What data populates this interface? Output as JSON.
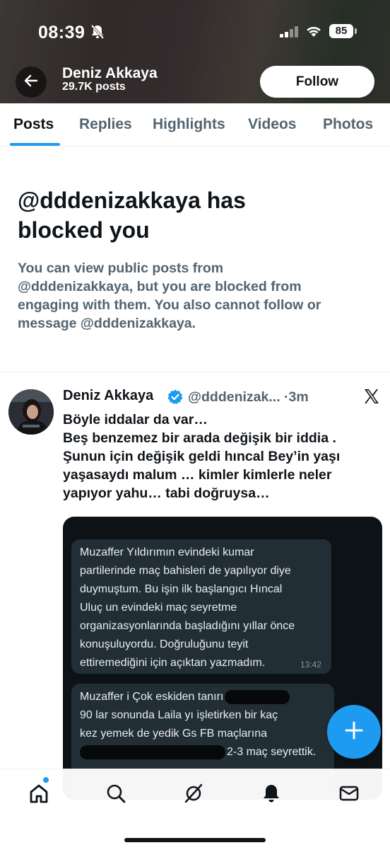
{
  "status_bar": {
    "time": "08:39",
    "battery": "85"
  },
  "profile_header": {
    "name": "Deniz Akkaya",
    "post_count": "29.7K posts",
    "follow_label": "Follow"
  },
  "tabs": [
    {
      "label": "Posts",
      "active": true
    },
    {
      "label": "Replies",
      "active": false
    },
    {
      "label": "Highlights",
      "active": false
    },
    {
      "label": "Videos",
      "active": false
    },
    {
      "label": "Photos",
      "active": false
    }
  ],
  "blocked": {
    "title_lines": [
      "@dddenizakkaya has",
      "blocked you"
    ],
    "message_lines": [
      "You can view public posts from",
      "@dddenizakkaya, but you are blocked from",
      "engaging with them. You also cannot follow or",
      "message @dddenizakkaya."
    ]
  },
  "post": {
    "author_name": "Deniz Akkaya",
    "handle_time": "@dddenizak... ·3m",
    "lines": [
      "Böyle iddalar da var…",
      "Beş benzemez bir arada değişik bir iddia .",
      "Şunun için değişik geldi hıncal Bey’in yaşı",
      "yaşasaydı malum … kimler kimlerle neler",
      "yapıyor yahu… tabi doğruysa…"
    ],
    "media": {
      "message1": {
        "lines": [
          "Muzaffer Yıldırımın evindeki kumar",
          "partilerinde maç bahisleri de yapılıyor diye",
          "duymuştum. Bu işin ilk başlangıcı Hıncal",
          "Uluç un evindeki maç seyretme",
          "organizasyonlarında başladığını yıllar önce",
          "konuşuluyordu. Doğruluğunu teyit",
          "ettiremediğini için açıktan yazmadım."
        ],
        "time": "13:42"
      },
      "message2": {
        "line1": "Muzaffer i Çok eskiden tanırı",
        "line2": "90 lar sonunda Laila yı işletirken bir kaç",
        "line3": "kez yemek de yedik Gs FB  maçlarına",
        "line4": "2-3 maç seyrettik."
      }
    }
  },
  "colors": {
    "accent": "#1d9bf0",
    "text_primary": "#0f1419",
    "text_secondary": "#536471"
  },
  "icons": [
    "back-arrow-icon",
    "bell-slash-icon",
    "signal-icon",
    "wifi-icon",
    "verified-badge-icon",
    "x-logo-icon",
    "compose-plus-icon",
    "home-icon",
    "search-icon",
    "grok-icon",
    "notifications-bell-icon",
    "messages-envelope-icon"
  ]
}
